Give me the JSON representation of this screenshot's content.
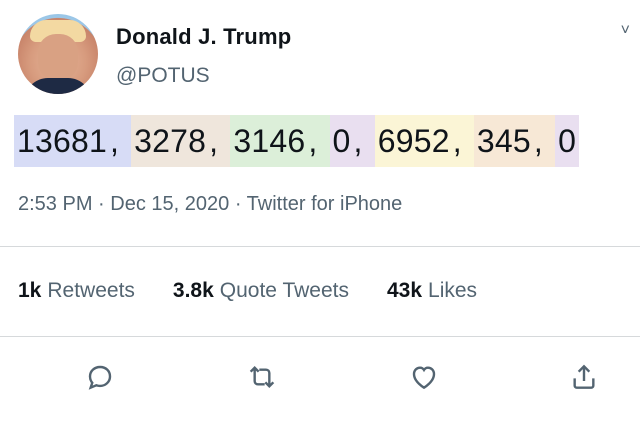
{
  "author": {
    "name": "Donald J. Trump",
    "handle": "@POTUS"
  },
  "tweet": {
    "tokens": [
      {
        "text": "13681",
        "bg": "#d7dcf6"
      },
      {
        "text": "3278",
        "bg": "#efe6dc"
      },
      {
        "text": "3146",
        "bg": "#dcefd9"
      },
      {
        "text": "0",
        "bg": "#e9dff0"
      },
      {
        "text": "6952",
        "bg": "#fbf5d6"
      },
      {
        "text": "345",
        "bg": "#f7e8d6"
      },
      {
        "text": "0",
        "bg": "#e9dff0"
      }
    ],
    "separator": ","
  },
  "meta": {
    "time": "2:53 PM",
    "date": "Dec 15, 2020",
    "source": "Twitter for iPhone",
    "dot": "·"
  },
  "stats": {
    "retweets": {
      "value": "1k",
      "label": "Retweets"
    },
    "quotes": {
      "value": "3.8k",
      "label": "Quote Tweets"
    },
    "likes": {
      "value": "43k",
      "label": "Likes"
    }
  },
  "actions": [
    "reply-icon",
    "retweet-icon",
    "like-icon",
    "share-icon"
  ]
}
